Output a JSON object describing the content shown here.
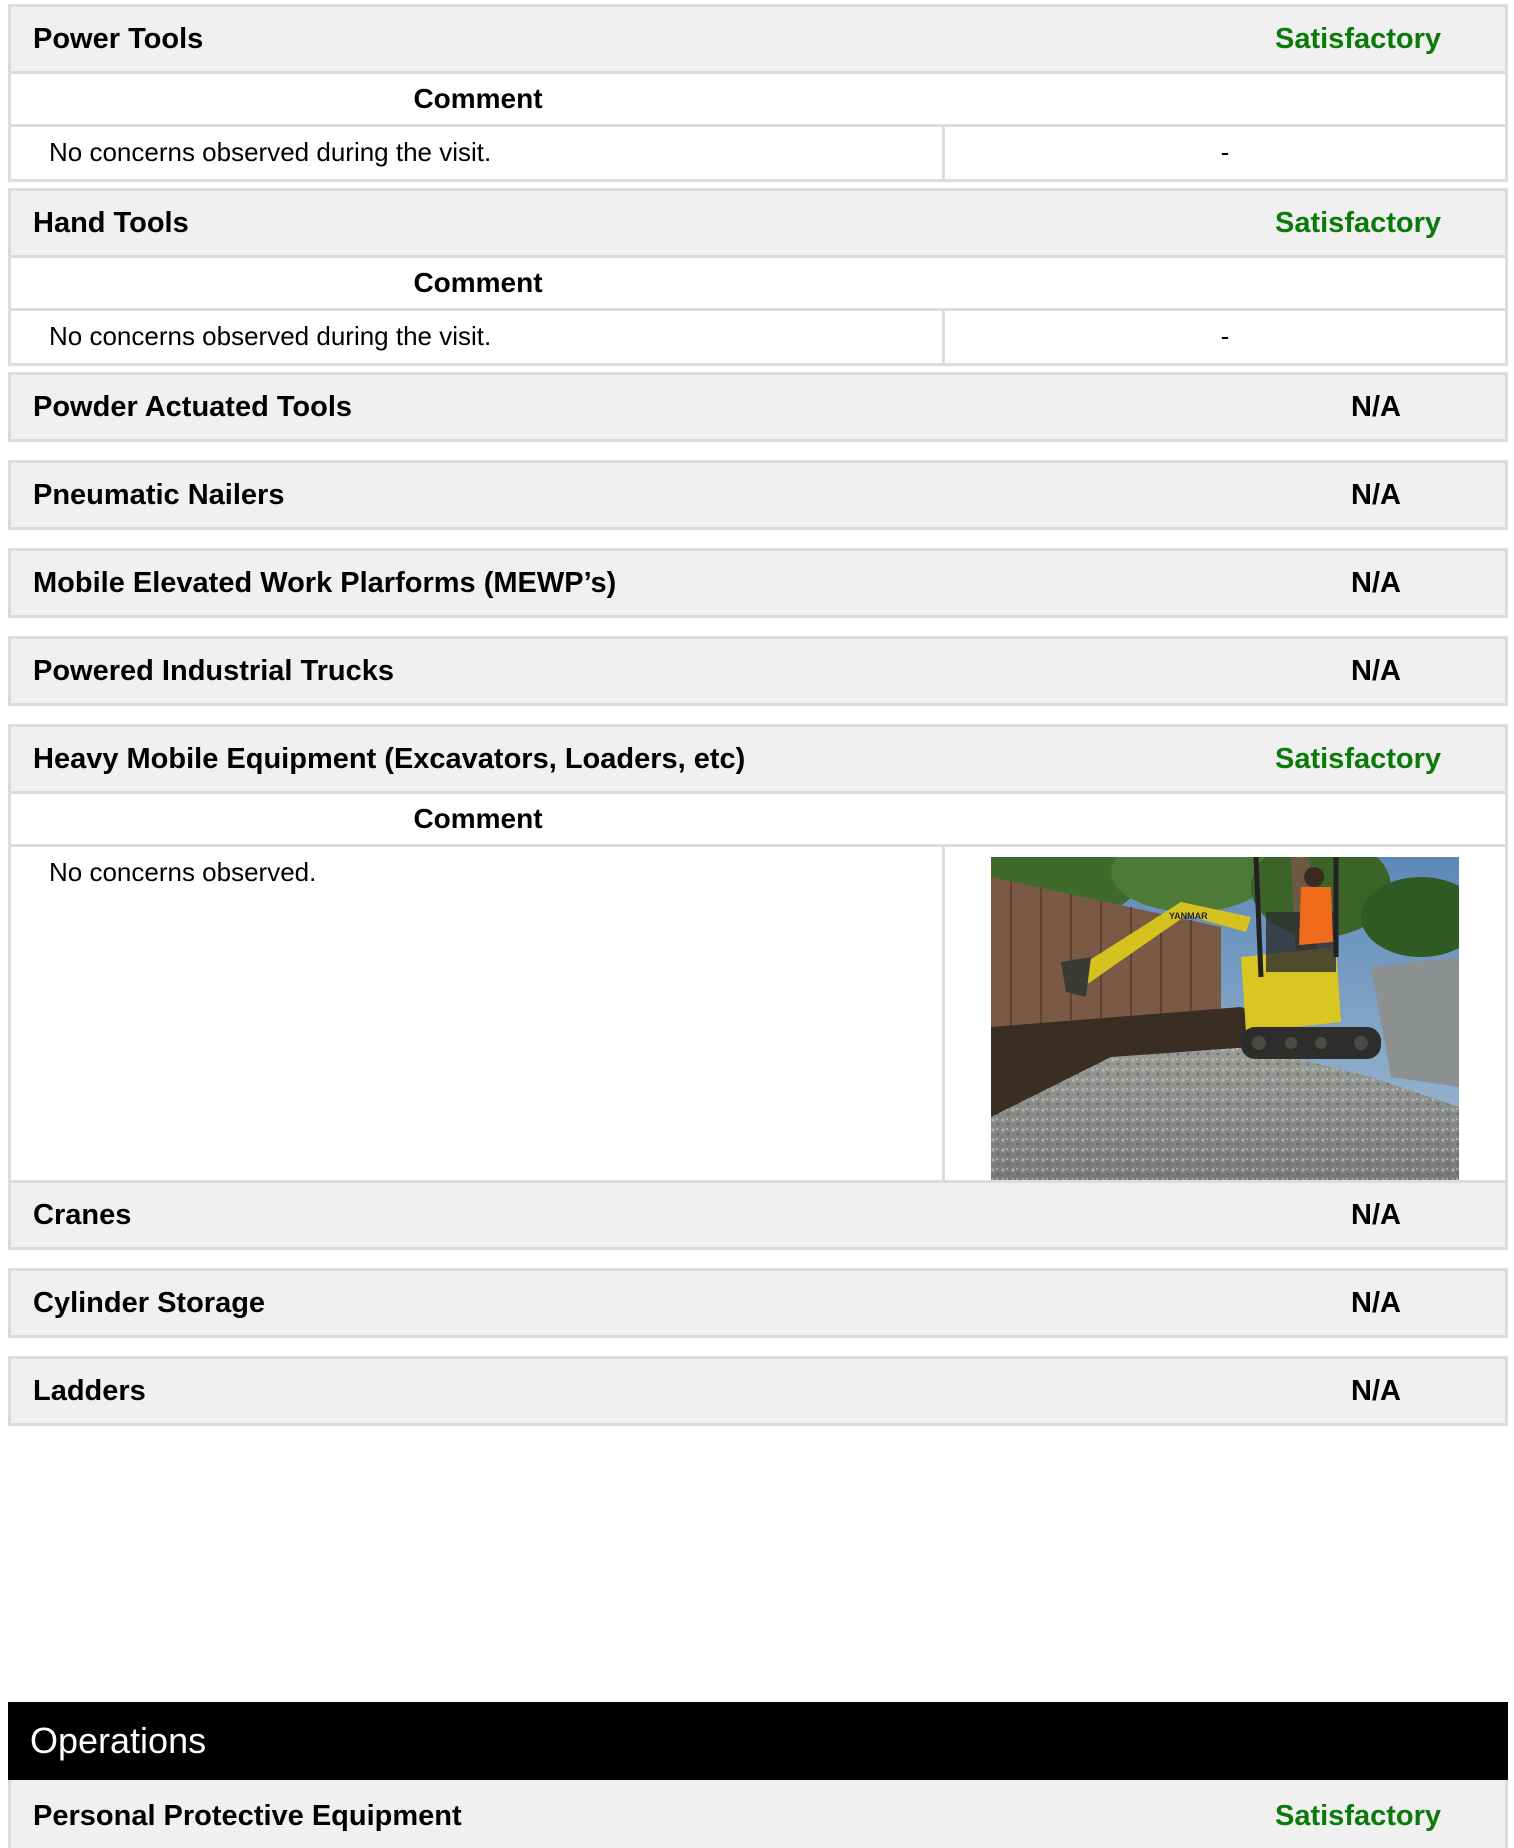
{
  "colors": {
    "satisfactory": "#0b7a0b",
    "na": "#000000",
    "header_bg": "#f0f0f0",
    "border": "#dcdcdc",
    "operations_bg": "#000000"
  },
  "comment_label": "Comment",
  "items": [
    {
      "title": "Power Tools",
      "status": "Satisfactory",
      "comment": "No concerns observed during the visit.",
      "media_text": "-"
    },
    {
      "title": "Hand Tools",
      "status": "Satisfactory",
      "comment": "No concerns observed during the visit.",
      "media_text": "-"
    },
    {
      "title": "Powder Actuated Tools",
      "status": "N/A"
    },
    {
      "title": "Pneumatic Nailers",
      "status": "N/A"
    },
    {
      "title": "Mobile Elevated Work Plarforms (MEWP’s)",
      "status": "N/A"
    },
    {
      "title": "Powered Industrial Trucks",
      "status": "N/A"
    },
    {
      "title": "Heavy Mobile Equipment (Excavators, Loaders, etc)",
      "status": "Satisfactory",
      "comment": "No concerns observed.",
      "photo_brand": "YANMAR"
    },
    {
      "title": "Cranes",
      "status": "N/A"
    },
    {
      "title": "Cylinder Storage",
      "status": "N/A"
    },
    {
      "title": "Ladders",
      "status": "N/A"
    }
  ],
  "operations": {
    "title": "Operations",
    "items": [
      {
        "title": "Personal Protective Equipment",
        "status": "Satisfactory"
      }
    ]
  }
}
